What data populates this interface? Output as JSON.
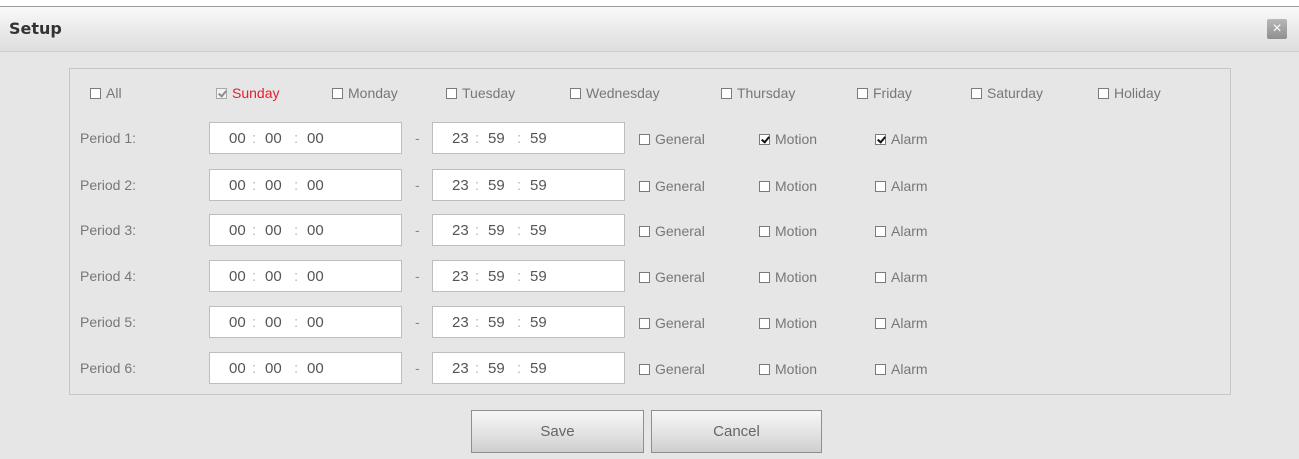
{
  "window": {
    "title": "Setup",
    "close_label": "×"
  },
  "days": [
    {
      "label": "All",
      "checked": false,
      "disabled": false,
      "highlight": false
    },
    {
      "label": "Sunday",
      "checked": true,
      "disabled": true,
      "highlight": true
    },
    {
      "label": "Monday",
      "checked": false,
      "disabled": false,
      "highlight": false
    },
    {
      "label": "Tuesday",
      "checked": false,
      "disabled": false,
      "highlight": false
    },
    {
      "label": "Wednesday",
      "checked": false,
      "disabled": false,
      "highlight": false
    },
    {
      "label": "Thursday",
      "checked": false,
      "disabled": false,
      "highlight": false
    },
    {
      "label": "Friday",
      "checked": false,
      "disabled": false,
      "highlight": false
    },
    {
      "label": "Saturday",
      "checked": false,
      "disabled": false,
      "highlight": false
    },
    {
      "label": "Holiday",
      "checked": false,
      "disabled": false,
      "highlight": false
    }
  ],
  "time_separator": ":",
  "range_separator": "-",
  "periods": [
    {
      "label": "Period 1:",
      "start": [
        "00",
        "00",
        "00"
      ],
      "end": [
        "23",
        "59",
        "59"
      ],
      "general": false,
      "motion": true,
      "alarm": true
    },
    {
      "label": "Period 2:",
      "start": [
        "00",
        "00",
        "00"
      ],
      "end": [
        "23",
        "59",
        "59"
      ],
      "general": false,
      "motion": false,
      "alarm": false
    },
    {
      "label": "Period 3:",
      "start": [
        "00",
        "00",
        "00"
      ],
      "end": [
        "23",
        "59",
        "59"
      ],
      "general": false,
      "motion": false,
      "alarm": false
    },
    {
      "label": "Period 4:",
      "start": [
        "00",
        "00",
        "00"
      ],
      "end": [
        "23",
        "59",
        "59"
      ],
      "general": false,
      "motion": false,
      "alarm": false
    },
    {
      "label": "Period 5:",
      "start": [
        "00",
        "00",
        "00"
      ],
      "end": [
        "23",
        "59",
        "59"
      ],
      "general": false,
      "motion": false,
      "alarm": false
    },
    {
      "label": "Period 6:",
      "start": [
        "00",
        "00",
        "00"
      ],
      "end": [
        "23",
        "59",
        "59"
      ],
      "general": false,
      "motion": false,
      "alarm": false
    }
  ],
  "event_labels": {
    "general": "General",
    "motion": "Motion",
    "alarm": "Alarm"
  },
  "buttons": {
    "save": "Save",
    "cancel": "Cancel"
  },
  "colors": {
    "highlight_text": "#e0202f",
    "dialog_bg": "#e6e6e6"
  }
}
